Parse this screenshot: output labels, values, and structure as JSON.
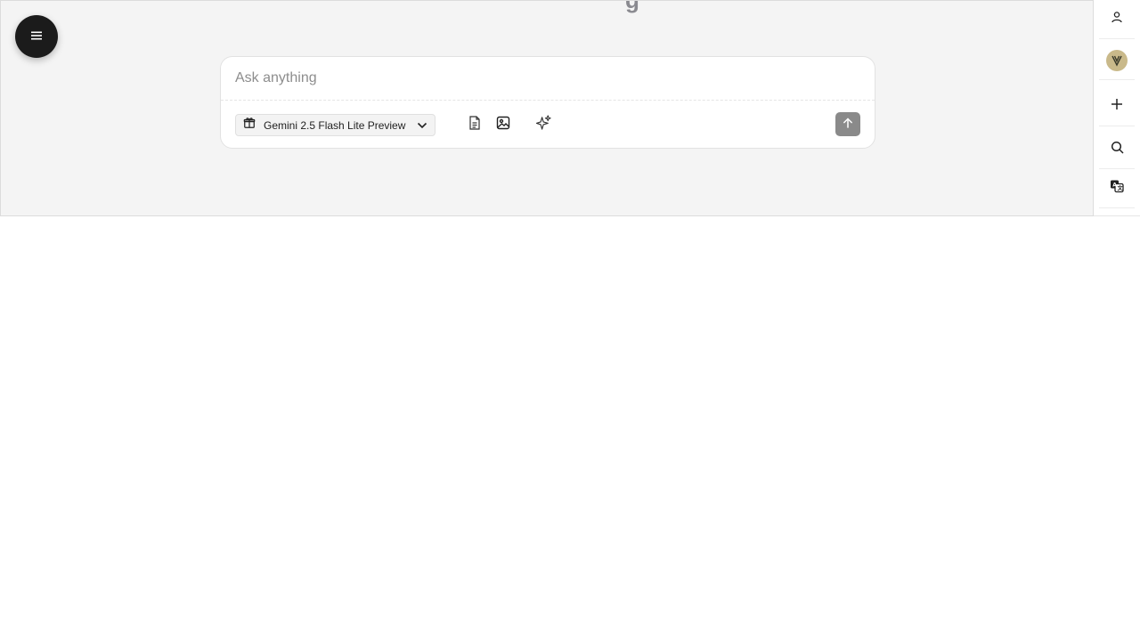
{
  "composer": {
    "placeholder": "Ask anything",
    "model_label": "Gemini 2.5 Flash Lite Preview"
  },
  "heading_fragment": "g",
  "icons": {
    "menu": "hamburger-menu-icon",
    "model": "gift-icon",
    "chevron": "chevron-down-icon",
    "file": "document-icon",
    "image": "image-icon",
    "sparkle": "sparkle-icon",
    "send": "arrow-up-icon",
    "rail": [
      "user-icon",
      "avatar",
      "plus-icon",
      "search-icon",
      "translate-icon"
    ]
  },
  "colors": {
    "panel_bg": "#f4f4f4",
    "menu_button": "#1b1b1b",
    "send_button": "#8a8a8a",
    "avatar_bg": "#c9b98a"
  }
}
